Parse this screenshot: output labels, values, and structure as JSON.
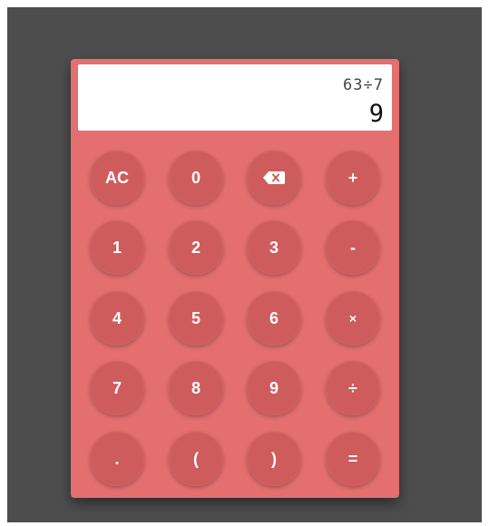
{
  "display": {
    "expression": "63÷7",
    "result": "9"
  },
  "keys": {
    "clear": "AC",
    "zero": "0",
    "backspace_icon": "backspace-icon",
    "plus": "+",
    "one": "1",
    "two": "2",
    "three": "3",
    "minus": "-",
    "four": "4",
    "five": "5",
    "six": "6",
    "multiply": "×",
    "seven": "7",
    "eight": "8",
    "nine": "9",
    "divide": "÷",
    "decimal": ".",
    "open_paren": "(",
    "close_paren": ")",
    "equals": "="
  },
  "colors": {
    "background": "#4d4d4d",
    "calculator_body": "#e36f6f",
    "key": "#cf5c5c",
    "key_text": "#ffffff",
    "display_bg": "#ffffff"
  }
}
